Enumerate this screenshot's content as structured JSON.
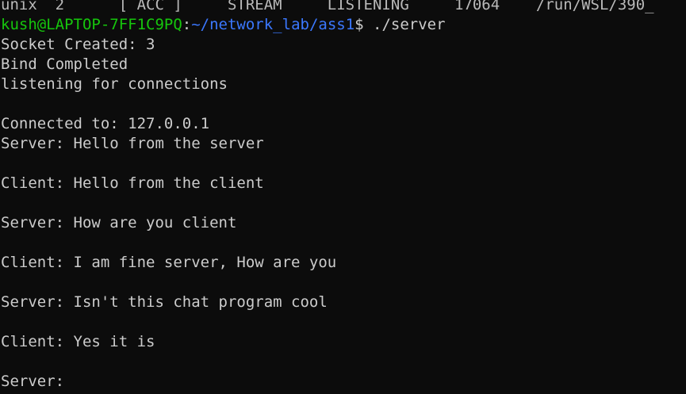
{
  "terminal": {
    "top_cut_line": "unix  2      [ ACC ]     STREAM     LISTENING     17064    /run/WSL/390_",
    "prompt": {
      "user_host": "kush@LAPTOP-7FF1C9PQ",
      "separator": ":",
      "path": "~/network_lab/ass1",
      "symbol": "$ ",
      "command": "./server"
    },
    "lines": [
      "Socket Created: 3",
      "Bind Completed",
      "listening for connections",
      "",
      "Connected to: 127.0.0.1",
      "Server: Hello from the server",
      "",
      "Client: Hello from the client",
      "",
      "Server: How are you client",
      "",
      "Client: I am fine server, How are you",
      "",
      "Server: Isn't this chat program cool",
      "",
      "Client: Yes it is",
      "",
      "Server: "
    ]
  },
  "colors": {
    "background": "#0c0c0c",
    "foreground": "#cccccc",
    "user_host": "#16c60c",
    "path": "#3b78ff"
  }
}
